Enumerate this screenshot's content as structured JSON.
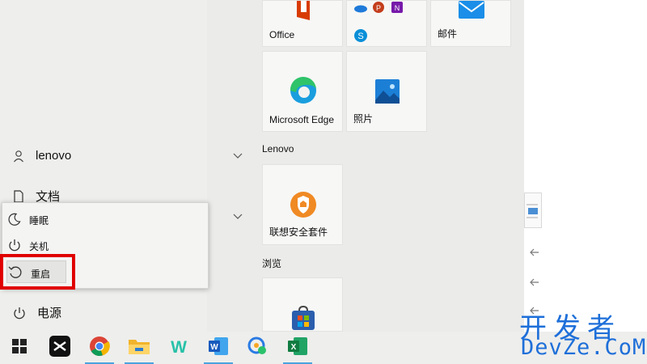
{
  "left_menu": {
    "user_name": "lenovo",
    "documents_label": "文档",
    "power_label": "电源"
  },
  "power_flyout": {
    "sleep_label": "睡眠",
    "shutdown_label": "关机",
    "restart_label": "重启"
  },
  "tiles": {
    "office_label": "Office",
    "mail_label": "邮件",
    "edge_label": "Microsoft Edge",
    "photos_label": "照片",
    "lenovo_security_label": "联想安全套件"
  },
  "groups": {
    "lenovo_label": "Lenovo",
    "browse_label": "浏览"
  },
  "taskbar": {
    "items": [
      "windows-start",
      "capcut",
      "chrome",
      "file-explorer",
      "wps",
      "word",
      "chat-app",
      "excel"
    ]
  },
  "watermark": {
    "top": "开发者",
    "bottom": "DevZe.CoM"
  },
  "colors": {
    "highlight": "#e00000",
    "accent": "#1e6fd9"
  }
}
